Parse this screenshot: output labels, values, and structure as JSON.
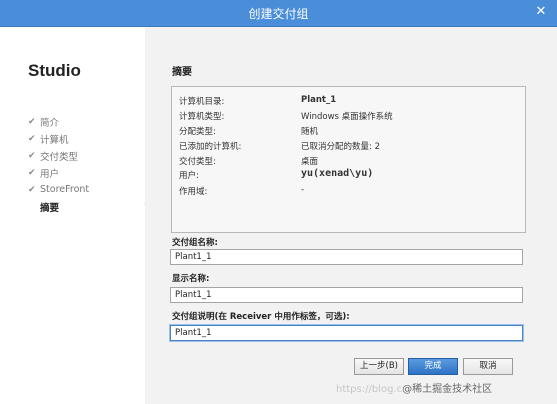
{
  "window": {
    "title": "创建交付组"
  },
  "sidebar": {
    "app_title": "Studio",
    "steps": [
      {
        "label": "简介",
        "done": true
      },
      {
        "label": "计算机",
        "done": true
      },
      {
        "label": "交付类型",
        "done": true
      },
      {
        "label": "用户",
        "done": true
      },
      {
        "label": "StoreFront",
        "done": true
      },
      {
        "label": "摘要",
        "done": false,
        "current": true
      }
    ]
  },
  "main": {
    "heading": "摘要",
    "summary": [
      {
        "key": "计算机目录:",
        "value": "Plant_1"
      },
      {
        "key": "计算机类型:",
        "value": "Windows 桌面操作系统"
      },
      {
        "key": "分配类型:",
        "value": "随机"
      },
      {
        "key": "已添加的计算机:",
        "value": "已取消分配的数量: 2"
      },
      {
        "key": "交付类型:",
        "value": "桌面"
      },
      {
        "key": "用户:",
        "value": "yu(xenad\\yu)"
      },
      {
        "key": "作用域:",
        "value": "-"
      }
    ],
    "fields": {
      "group_name": {
        "label": "交付组名称:",
        "value": "Plant1_1"
      },
      "display_name": {
        "label": "显示名称:",
        "value": "Plant1_1"
      },
      "description": {
        "label": "交付组说明(在 Receiver 中用作标签，可选):",
        "value": "Plant1_1"
      }
    }
  },
  "buttons": {
    "back": "上一步(B)",
    "finish": "完成",
    "cancel": "取消"
  },
  "watermark": {
    "text": "https://blog.c",
    "brand": "@稀土掘金技术社区"
  }
}
